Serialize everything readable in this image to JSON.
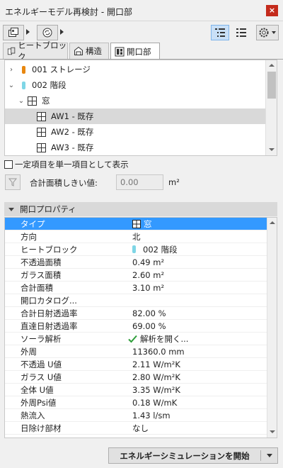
{
  "window": {
    "title": "エネルギーモデル再検討 - 開口部",
    "close_label": "×"
  },
  "tabs": [
    {
      "label": "ヒートブロック",
      "icon": "heat-block-icon"
    },
    {
      "label": "構造",
      "icon": "structure-icon"
    },
    {
      "label": "開口部",
      "icon": "openings-icon"
    }
  ],
  "tree": {
    "items": [
      {
        "label": "001 ストレージ",
        "marker_color": "#e8870f"
      },
      {
        "label": "002 階段",
        "marker_color": "#7fd6e6"
      },
      {
        "label": "窓"
      },
      {
        "label": "AW1 - 既存"
      },
      {
        "label": "AW2 - 既存"
      },
      {
        "label": "AW3 - 既存"
      }
    ]
  },
  "options": {
    "single_item_label": "一定項目を単一項目として表示",
    "threshold_label": "合計面積しきい値:",
    "threshold_placeholder": "0.00",
    "threshold_unit": "m²"
  },
  "properties": {
    "section_title": "開口プロパティ",
    "rows": [
      {
        "key": "タイプ",
        "value": "窓"
      },
      {
        "key": "方向",
        "value": "北"
      },
      {
        "key": "ヒートブロック",
        "value": "002 階段"
      },
      {
        "key": "不透過面積",
        "value": "0.49 m²"
      },
      {
        "key": "ガラス面積",
        "value": "2.60 m²"
      },
      {
        "key": "合計面積",
        "value": "3.10 m²"
      },
      {
        "key": "開口カタログ...",
        "value": ""
      },
      {
        "key": "合計日射透過率",
        "value": "82.00 %"
      },
      {
        "key": "直達日射透過率",
        "value": "69.00 %"
      },
      {
        "key": "ソーラ解析",
        "value": "解析を開く..."
      },
      {
        "key": "外周",
        "value": "11360.0 mm"
      },
      {
        "key": "不透過 U値",
        "value": "2.11 W/m²K"
      },
      {
        "key": "ガラス U値",
        "value": "2.80 W/m²K"
      },
      {
        "key": "全体 U値",
        "value": "3.35 W/m²K"
      },
      {
        "key": "外周Psi値",
        "value": "0.18 W/mK"
      },
      {
        "key": "熱流入",
        "value": "1.43 l/sm"
      },
      {
        "key": "日除け部材",
        "value": "なし"
      }
    ]
  },
  "footer": {
    "run_label": "エネルギーシミュレーションを開始"
  },
  "colors": {
    "selection": "#3399ff",
    "check": "#2e9e3a"
  }
}
